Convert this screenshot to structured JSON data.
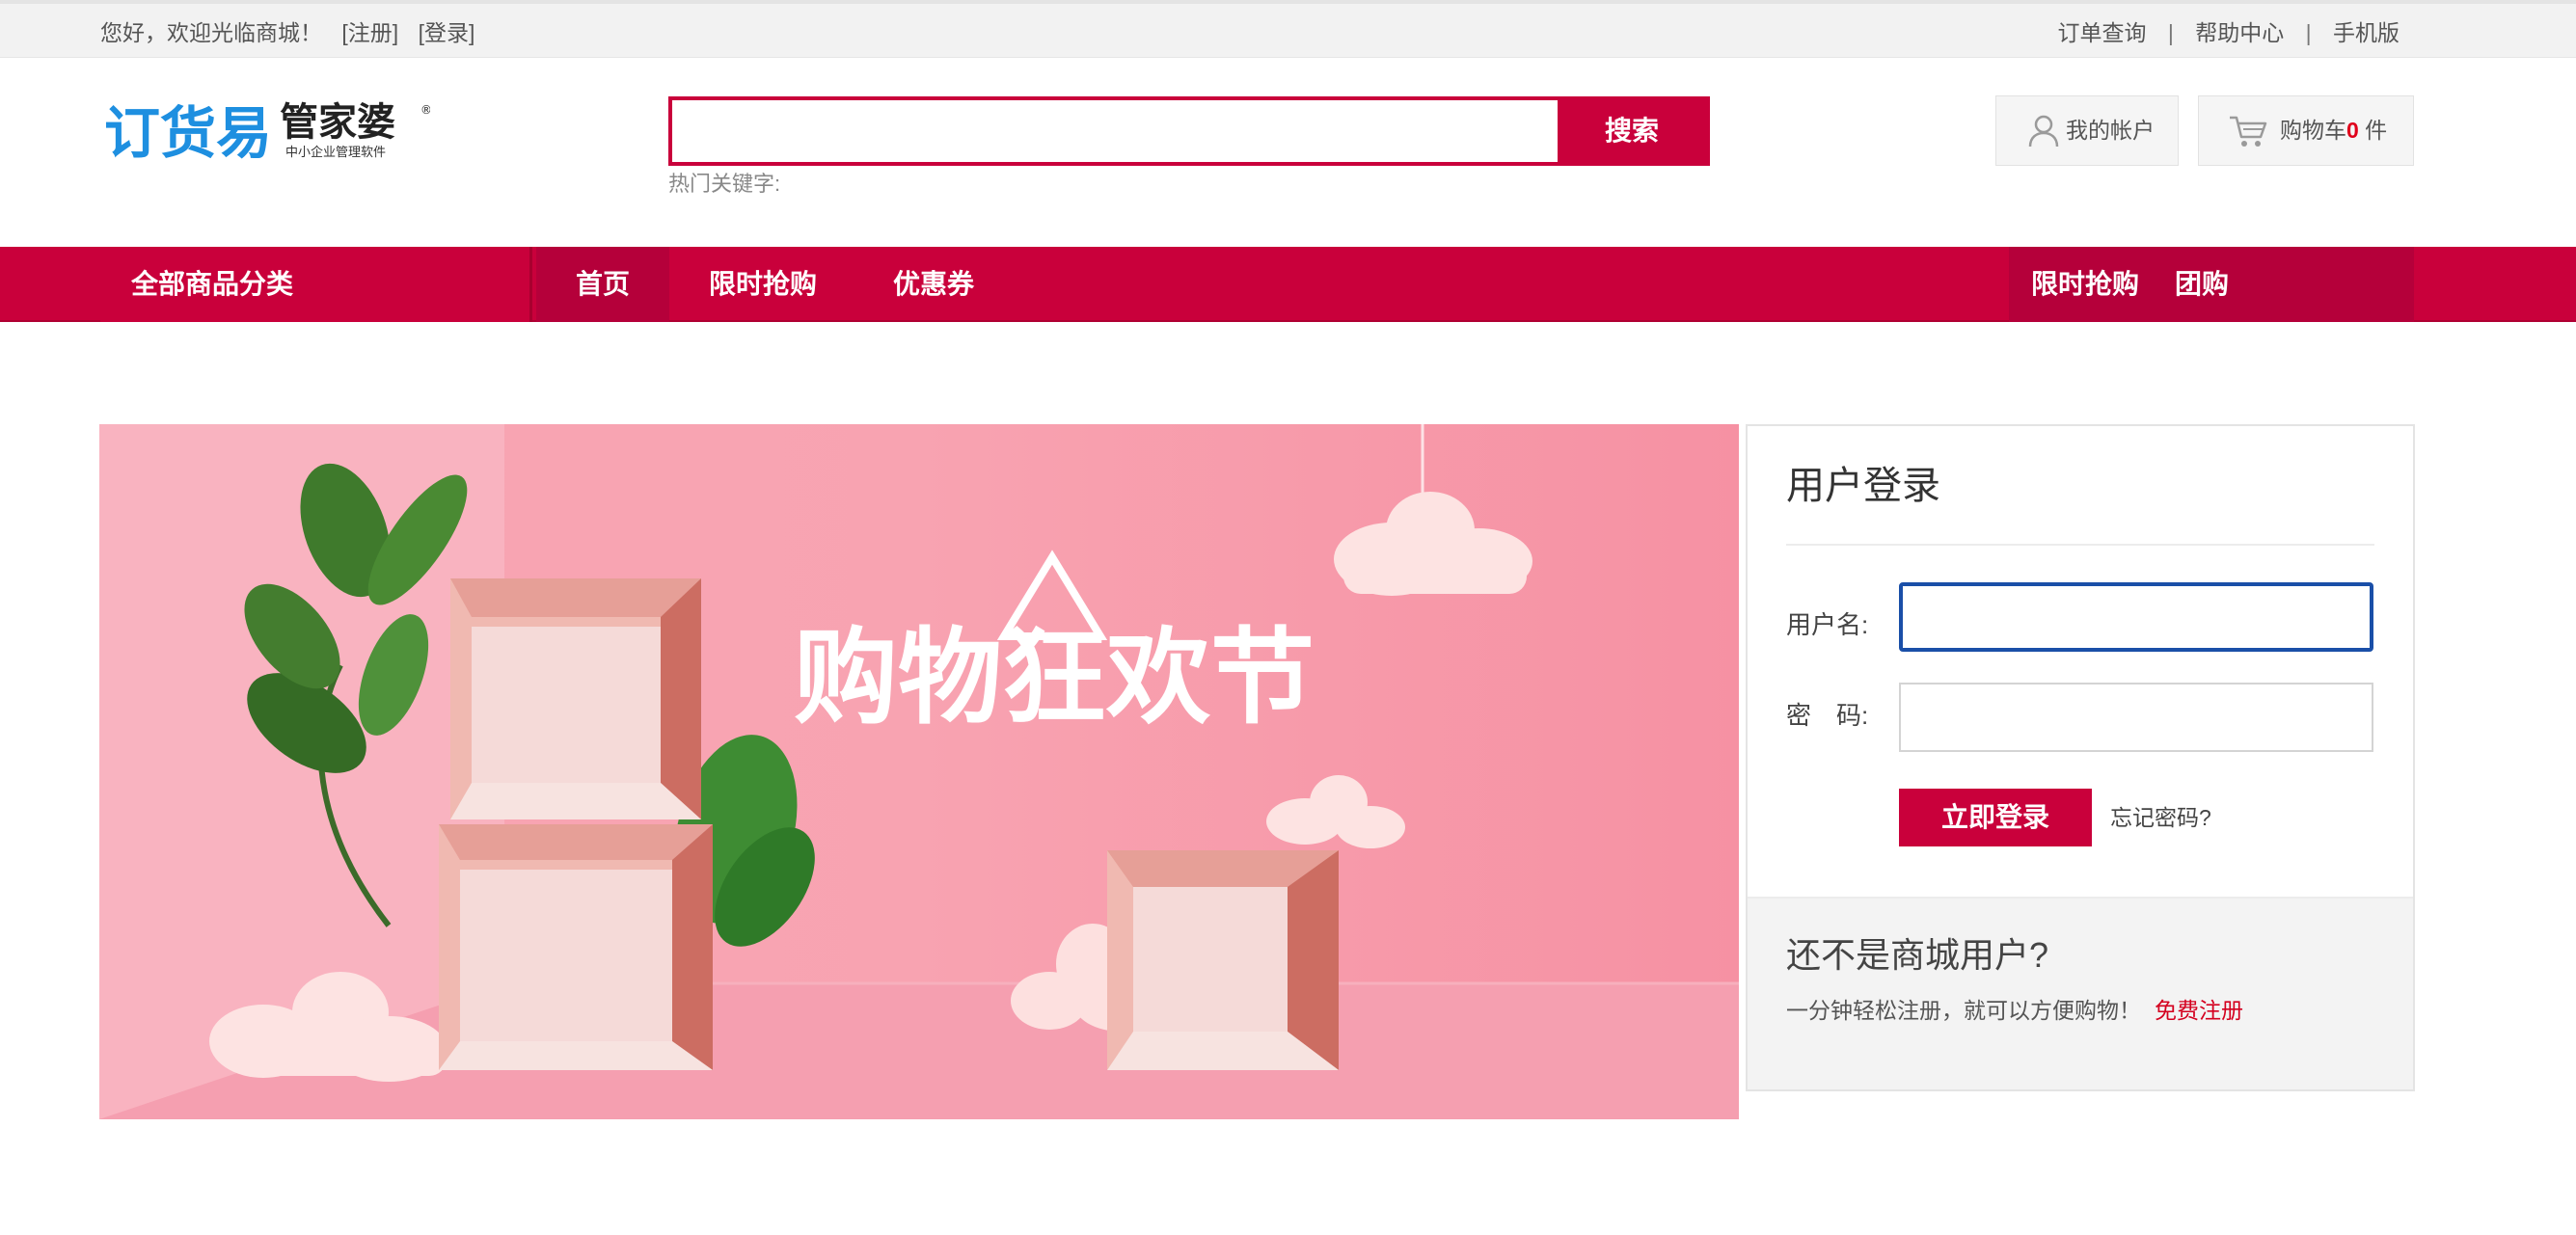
{
  "topbar": {
    "welcome": "您好，欢迎光临商城！",
    "register_link": "[注册]",
    "login_link": "[登录]",
    "links": [
      "订单查询",
      "帮助中心",
      "手机版"
    ],
    "separator": "|"
  },
  "header": {
    "logo_main": "订货易",
    "logo_brand": "管家婆",
    "logo_reg": "®",
    "logo_sub": "中小企业管理软件",
    "search": {
      "value": "",
      "placeholder": "",
      "button_label": "搜索",
      "hot_keywords_label": "热门关键字:"
    },
    "account_label": "我的帐户",
    "cart": {
      "prefix": "购物车",
      "count": "0",
      "suffix": " 件"
    }
  },
  "nav": {
    "category_label": "全部商品分类",
    "items": [
      "首页",
      "限时抢购",
      "优惠券"
    ],
    "right_items": [
      "限时抢购",
      "团购"
    ]
  },
  "banner": {
    "headline": "购物狂欢节"
  },
  "login": {
    "title": "用户登录",
    "username_label": "用户名:",
    "password_label": "密　码:",
    "username_value": "",
    "password_value": "",
    "submit_label": "立即登录",
    "forgot_label": "忘记密码?",
    "register_title": "还不是商城用户?",
    "register_desc": "一分钟轻松注册，就可以方便购物！",
    "register_link": "免费注册"
  },
  "colors": {
    "brand_red": "#c9003b",
    "logo_blue": "#1e8fe0",
    "focus_blue": "#1a4fa8",
    "banner_pink": "#f9a4b3"
  }
}
